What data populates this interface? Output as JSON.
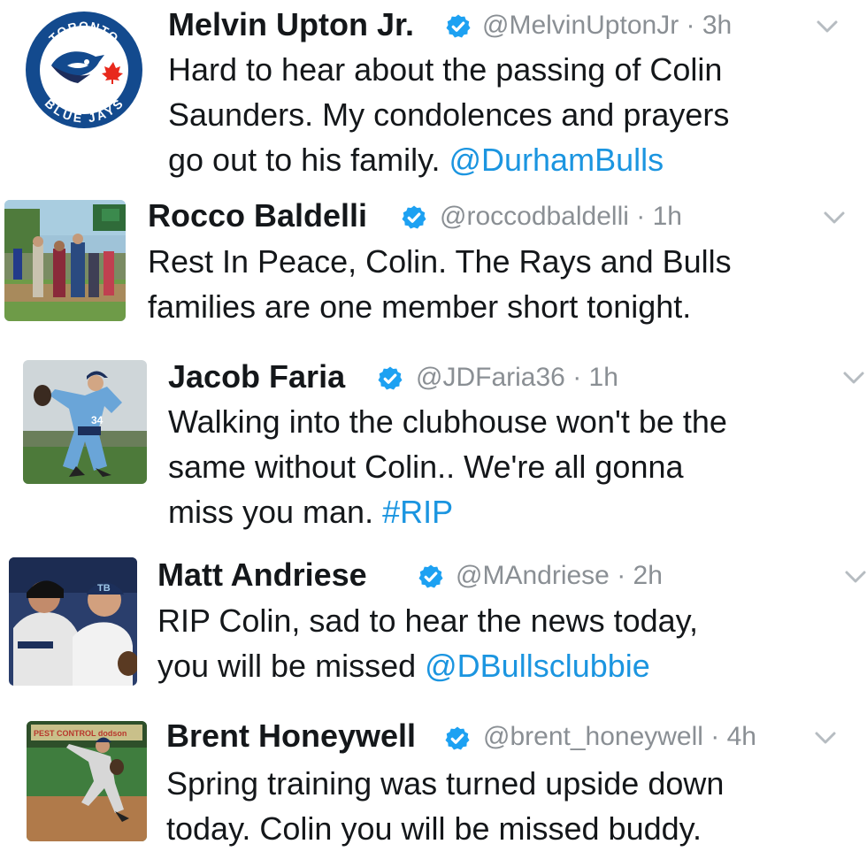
{
  "colors": {
    "link": "#1b95e0",
    "verified": "#1da1f2",
    "meta": "#8a8f94",
    "text": "#14171a"
  },
  "blue_jays_logo": {
    "ring_text_top": "TORONTO",
    "ring_text_bottom": "BLUE JAYS"
  },
  "tweets": [
    {
      "name": "Melvin Upton Jr.",
      "handle": "@MelvinUptonJr",
      "time": "3h",
      "lines": [
        "Hard to hear about the passing of Colin",
        "Saunders. My condolences and prayers",
        "go out to his family. "
      ],
      "link": "@DurhamBulls",
      "avatar_icon": "blue-jays-logo-icon"
    },
    {
      "name": "Rocco Baldelli",
      "handle": "@roccodbaldelli",
      "time": "1h",
      "lines": [
        "Rest In Peace, Colin. The Rays and Bulls",
        "families are one member short tonight."
      ],
      "avatar_icon": "ballfield-photo"
    },
    {
      "name": "Jacob Faria",
      "handle": "@JDFaria36",
      "time": "1h",
      "lines": [
        "Walking into the clubhouse won't be the",
        "same without Colin.. We're all gonna",
        "miss you man. "
      ],
      "link": "#RIP",
      "avatar_icon": "pitcher-photo"
    },
    {
      "name": "Matt Andriese",
      "handle": "@MAndriese",
      "time": "2h",
      "lines": [
        "RIP Colin, sad to hear the news today,",
        "you will be missed "
      ],
      "link": "@DBullsclubbie",
      "avatar_icon": "players-photo"
    },
    {
      "name": "Brent Honeywell",
      "handle": "@brent_honeywell",
      "time": "4h",
      "lines": [
        "Spring training was turned upside down",
        "today. Colin you will be missed buddy."
      ],
      "avatar_icon": "pitching-photo",
      "banner_text": "PEST CONTROL dodson"
    }
  ]
}
